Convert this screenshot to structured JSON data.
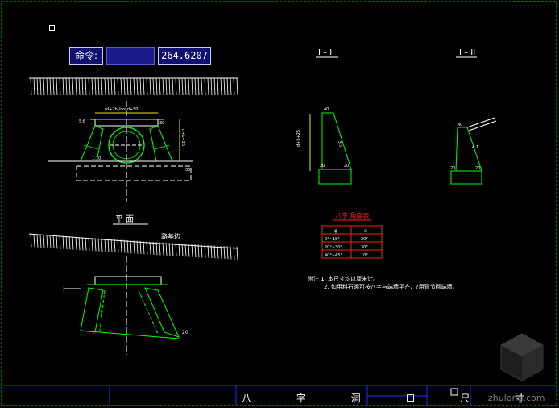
{
  "command_bar": {
    "label": "命令:",
    "input_value": "",
    "coordinate": "264.6207"
  },
  "drawing": {
    "section1_title": "I – I",
    "section2_title": "II – II",
    "plan_title": "平  面",
    "road_label": "路基边",
    "section_mark": "I",
    "dim_culvert_width": "(d+2b)/cosd+50",
    "dim_left": "5:6",
    "dim_right": "39",
    "dim_height": "d+b+25",
    "dim_base": "30",
    "dim_slope": "1:10",
    "dim_plan_20": "20",
    "sec1_top": "40",
    "sec1_h": "d+b+25",
    "sec1_slope": "3:1",
    "sec1_left": "20",
    "sec1_right": "20",
    "sec2_top": "40",
    "sec2_slope": "4:1",
    "sec2_left": "20",
    "sec2_right": "20"
  },
  "table": {
    "title": "八字  角度表",
    "headers": [
      "φ",
      "α"
    ],
    "rows": [
      [
        "0°~15°",
        "20°"
      ],
      [
        "20°~30°",
        "30°"
      ],
      [
        "40°~45°",
        "10°"
      ]
    ]
  },
  "notes": {
    "line1": "附注 1. 本尺寸均以厘米计。",
    "line2": "2. 如用料石砌可按八字与端墙平齐，?用管节砌端墙。"
  },
  "title_block": {
    "text": "八 字 洞 口 尺 寸"
  },
  "watermark": "zhulong.com",
  "colors": {
    "background": "#000000",
    "line_white": "#ffffff",
    "line_green": "#00ff00",
    "dim_yellow": "#e8e800",
    "hatch_green": "#00c000",
    "table_red": "#ff2020",
    "border_green": "#00cc00"
  }
}
